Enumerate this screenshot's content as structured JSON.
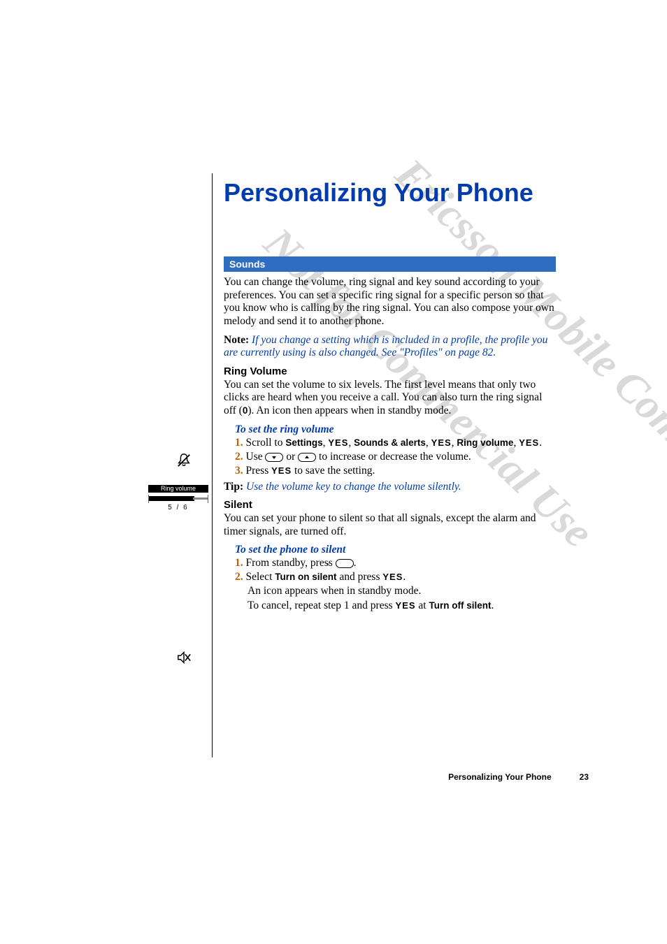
{
  "watermark1": "Not for Commercial Use",
  "watermark2": "Ericsson Mobile Communications AB",
  "chapter_title": "Personalizing Your Phone",
  "section_bar": "Sounds",
  "intro_para": "You can change the volume, ring signal and key sound according to your preferences. You can set a specific ring signal for a specific person so that you know who is calling by the ring signal. You can also compose your own melody and send it to another phone.",
  "note_label": "Note:",
  "note_text": "If you change a setting which is included in a profile, the profile you are currently using is also changed. See \"Profiles\" on page 82.",
  "ring_volume": {
    "heading": "Ring Volume",
    "para": "You can set the volume to six levels. The first level means that only two clicks are heard when you receive a call. You can also turn the ring signal off (",
    "zero": "0",
    "para_tail": "). An icon then appears when in standby mode.",
    "proc_title": "To set the ring volume",
    "step1_pre": "Scroll to ",
    "step1_a": "Settings",
    "step1_b": "Sounds & alerts",
    "step1_c": "Ring volume",
    "step2_pre": "Use ",
    "step2_mid": " or ",
    "step2_post": " to increase or decrease the volume.",
    "step3_pre": "Press ",
    "step3_post": " to save the setting."
  },
  "tip_label": "Tip:",
  "tip_text": "Use the volume key to change the volume silently.",
  "silent": {
    "heading": "Silent",
    "para": "You can set your phone to silent so that all signals, except the alarm and timer signals, are turned off.",
    "proc_title": "To set the phone to silent",
    "step1_pre": "From standby, press ",
    "step1_post": ".",
    "step2_pre": "Select ",
    "step2_bold": "Turn on silent",
    "step2_mid": " and press ",
    "step2_post": ".",
    "sub1": "An icon appears when in standby mode.",
    "sub2_pre": "To cancel, repeat step 1 and press ",
    "sub2_mid": " at ",
    "sub2_bold": "Turn off silent",
    "sub2_post": "."
  },
  "yes": "YES",
  "comma": ", ",
  "margin_screen": {
    "title": "Ring volume",
    "level": "5 / 6"
  },
  "footer": {
    "title": "Personalizing Your Phone",
    "page": "23"
  },
  "steps": {
    "n1": "1.",
    "n2": "2.",
    "n3": "3."
  }
}
